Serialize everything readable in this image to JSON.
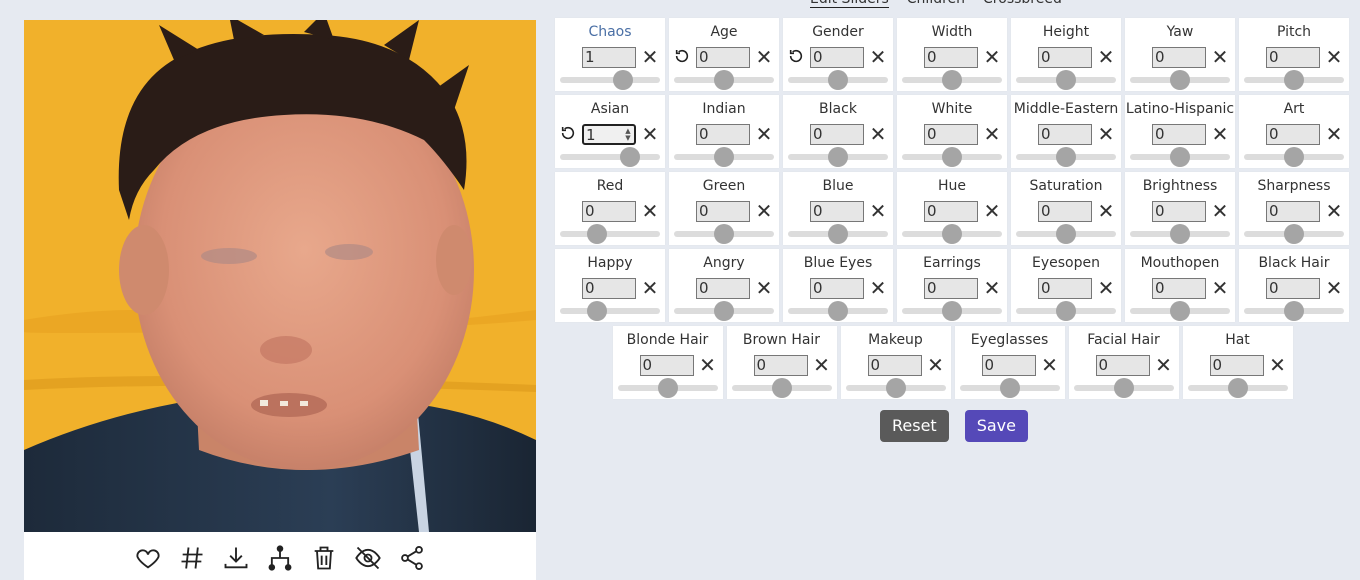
{
  "top_tabs": [
    "Edit Sliders",
    "Children",
    "Crossbreed"
  ],
  "image": {
    "description_icon": "generated-face-photo"
  },
  "actions": [
    {
      "name": "heart-icon"
    },
    {
      "name": "hash-icon"
    },
    {
      "name": "download-icon"
    },
    {
      "name": "tree-icon"
    },
    {
      "name": "trash-icon"
    },
    {
      "name": "eye-off-icon"
    },
    {
      "name": "share-icon"
    }
  ],
  "sliders": {
    "row1": [
      {
        "label": "Chaos",
        "value": "1",
        "reset": false,
        "accent": true,
        "level": 0.63
      },
      {
        "label": "Age",
        "value": "0",
        "reset": true,
        "level": 0.5
      },
      {
        "label": "Gender",
        "value": "0",
        "reset": true,
        "level": 0.5
      },
      {
        "label": "Width",
        "value": "0",
        "reset": false,
        "level": 0.5
      },
      {
        "label": "Height",
        "value": "0",
        "reset": false,
        "level": 0.5
      },
      {
        "label": "Yaw",
        "value": "0",
        "reset": false,
        "level": 0.5
      },
      {
        "label": "Pitch",
        "value": "0",
        "reset": false,
        "level": 0.5
      }
    ],
    "row2": [
      {
        "label": "Asian",
        "value": "1",
        "reset": true,
        "focused": true,
        "level": 0.7
      },
      {
        "label": "Indian",
        "value": "0",
        "reset": false,
        "level": 0.5
      },
      {
        "label": "Black",
        "value": "0",
        "reset": false,
        "level": 0.5
      },
      {
        "label": "White",
        "value": "0",
        "reset": false,
        "level": 0.5
      },
      {
        "label": "Middle-Eastern",
        "value": "0",
        "reset": false,
        "level": 0.5
      },
      {
        "label": "Latino-Hispanic",
        "value": "0",
        "reset": false,
        "level": 0.5
      },
      {
        "label": "Art",
        "value": "0",
        "reset": false,
        "level": 0.5
      }
    ],
    "row3": [
      {
        "label": "Red",
        "value": "0",
        "reset": false,
        "level": 0.37
      },
      {
        "label": "Green",
        "value": "0",
        "reset": false,
        "level": 0.5
      },
      {
        "label": "Blue",
        "value": "0",
        "reset": false,
        "level": 0.5
      },
      {
        "label": "Hue",
        "value": "0",
        "reset": false,
        "level": 0.5
      },
      {
        "label": "Saturation",
        "value": "0",
        "reset": false,
        "level": 0.5
      },
      {
        "label": "Brightness",
        "value": "0",
        "reset": false,
        "level": 0.5
      },
      {
        "label": "Sharpness",
        "value": "0",
        "reset": false,
        "level": 0.5
      }
    ],
    "row4": [
      {
        "label": "Happy",
        "value": "0",
        "reset": false,
        "level": 0.37
      },
      {
        "label": "Angry",
        "value": "0",
        "reset": false,
        "level": 0.5
      },
      {
        "label": "Blue Eyes",
        "value": "0",
        "reset": false,
        "level": 0.5
      },
      {
        "label": "Earrings",
        "value": "0",
        "reset": false,
        "level": 0.5
      },
      {
        "label": "Eyesopen",
        "value": "0",
        "reset": false,
        "level": 0.5
      },
      {
        "label": "Mouthopen",
        "value": "0",
        "reset": false,
        "level": 0.5
      },
      {
        "label": "Black Hair",
        "value": "0",
        "reset": false,
        "level": 0.5
      }
    ],
    "row5": [
      {
        "label": "Blonde Hair",
        "value": "0",
        "reset": false,
        "level": 0.5
      },
      {
        "label": "Brown Hair",
        "value": "0",
        "reset": false,
        "level": 0.5
      },
      {
        "label": "Makeup",
        "value": "0",
        "reset": false,
        "level": 0.5
      },
      {
        "label": "Eyeglasses",
        "value": "0",
        "reset": false,
        "level": 0.5
      },
      {
        "label": "Facial Hair",
        "value": "0",
        "reset": false,
        "level": 0.5
      },
      {
        "label": "Hat",
        "value": "0",
        "reset": false,
        "level": 0.5
      }
    ]
  },
  "buttons": {
    "reset": "Reset",
    "save": "Save"
  }
}
